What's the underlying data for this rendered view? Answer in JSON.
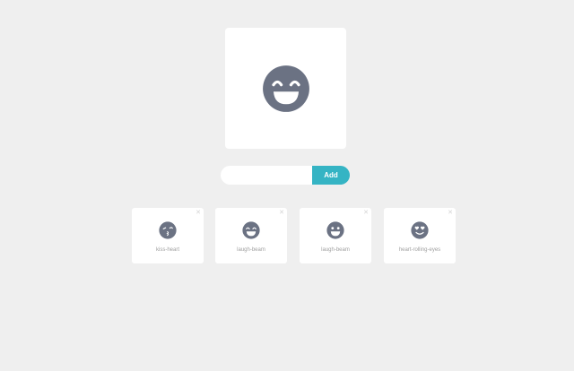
{
  "preview": {
    "icon": "smile-laughing-icon"
  },
  "form": {
    "input_value": "",
    "input_placeholder": "",
    "add_label": "Add"
  },
  "emojis": [
    {
      "label": "kiss-heart",
      "icon": "kissing-face-icon"
    },
    {
      "label": "laugh-beam",
      "icon": "laugh-beam-icon"
    },
    {
      "label": "laugh-beam",
      "icon": "grin-beam-icon"
    },
    {
      "label": "heart-rolling-eyes",
      "icon": "heart-eyes-icon"
    }
  ],
  "colors": {
    "background": "#efefef",
    "card": "#ffffff",
    "emoji": "#6b7283",
    "accent": "#35b4c4"
  }
}
